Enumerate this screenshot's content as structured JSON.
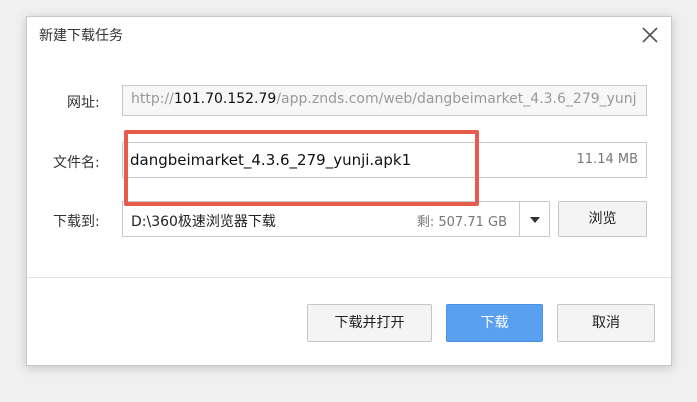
{
  "dialog": {
    "title": "新建下载任务",
    "close_icon": "close-icon"
  },
  "url_row": {
    "label": "网址:",
    "prefix": "http://",
    "host": "101.70.152.79",
    "path": "/app.znds.com/web/dangbeimarket_4.3.6_279_yunj"
  },
  "filename_row": {
    "label": "文件名:",
    "value": "dangbeimarket_4.3.6_279_yunji.apk1",
    "size": "11.14 MB"
  },
  "save_row": {
    "label": "下载到:",
    "path": "D:\\360极速浏览器下载",
    "free_space": "剩: 507.71 GB",
    "dropdown_icon": "chevron-down-icon",
    "browse_label": "浏览"
  },
  "buttons": {
    "download_open": "下载并打开",
    "download": "下载",
    "cancel": "取消"
  },
  "annotation": {
    "highlight_color": "#e85a4c"
  },
  "colors": {
    "primary_button": "#5aa0f0"
  }
}
